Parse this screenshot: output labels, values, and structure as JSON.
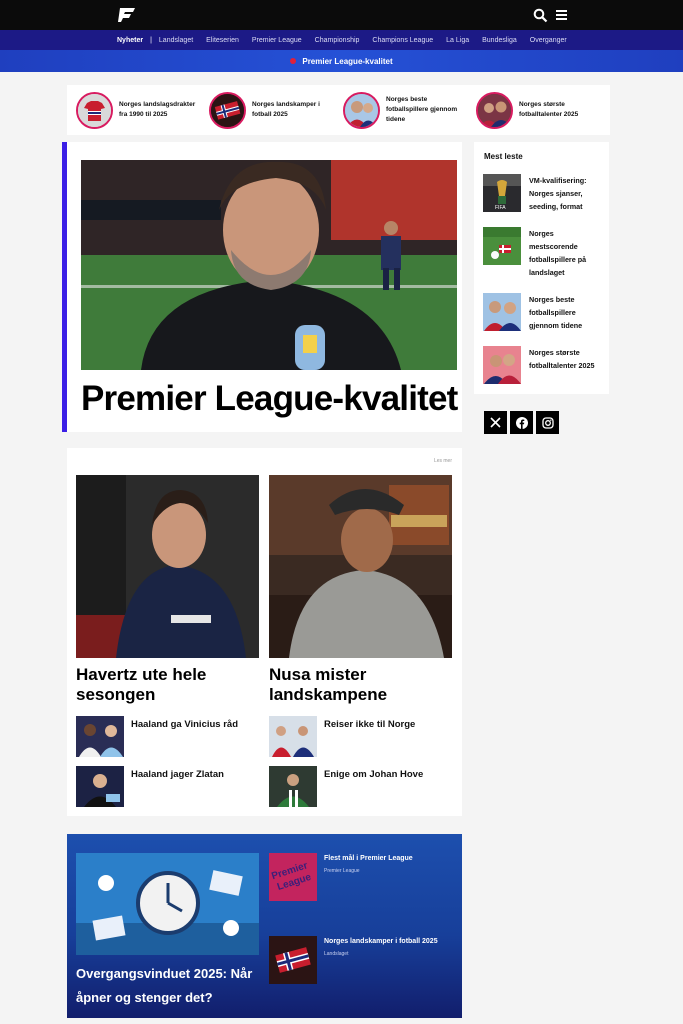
{
  "header": {
    "logo_icon": "fotball-logo-icon",
    "search_icon": "search-icon",
    "menu_icon": "hamburger-menu-icon"
  },
  "nav": {
    "active": "Nyheter",
    "items": [
      "Landslaget",
      "Eliteserien",
      "Premier League",
      "Championship",
      "Champions League",
      "La Liga",
      "Bundesliga",
      "Overganger"
    ]
  },
  "breaking": {
    "text": "Premier League-kvalitet",
    "dot_color": "#e0203a"
  },
  "quick_links": [
    {
      "label": "Norges landslagsdrakter fra 1990 til 2025",
      "icon": "norway-shirt-icon"
    },
    {
      "label": "Norges landskamper i fotball 2025",
      "icon": "norway-flag-icon"
    },
    {
      "label": "Norges beste fotballspillere gjennom tidene",
      "icon": "player-avatar-icon"
    },
    {
      "label": "Norges største fotballtalenter 2025",
      "icon": "player-avatar-icon"
    }
  ],
  "hero": {
    "title": "Premier League-kvalitet",
    "accent": "#3b1fe6"
  },
  "sidebar": {
    "title": "Mest leste",
    "items": [
      {
        "label": "VM-kvalifisering: Norges sjanser, seeding, format"
      },
      {
        "label": "Norges mestscorende fotballspillere på landslaget"
      },
      {
        "label": "Norges beste fotballspillere gjennom tidene"
      },
      {
        "label": "Norges største fotballtalenter 2025"
      }
    ],
    "social": [
      "x-icon",
      "facebook-icon",
      "instagram-icon"
    ]
  },
  "grid": {
    "more_label": "Les mer",
    "cards": [
      {
        "title": "Havertz ute hele sesongen"
      },
      {
        "title": "Nusa mister landskampene"
      }
    ],
    "small": [
      {
        "label": "Haaland ga Vinicius råd"
      },
      {
        "label": "Reiser ikke til Norge"
      },
      {
        "label": "Haaland jager Zlatan"
      },
      {
        "label": "Enige om Johan Hove"
      }
    ]
  },
  "feature": {
    "title": "Overgangsvinduet 2025: Når åpner og stenger det?",
    "items": [
      {
        "label": "Flest mål i Premier League",
        "category": "Premier League"
      },
      {
        "label": "Norges landskamper i fotball 2025",
        "category": "Landslaget"
      }
    ]
  }
}
